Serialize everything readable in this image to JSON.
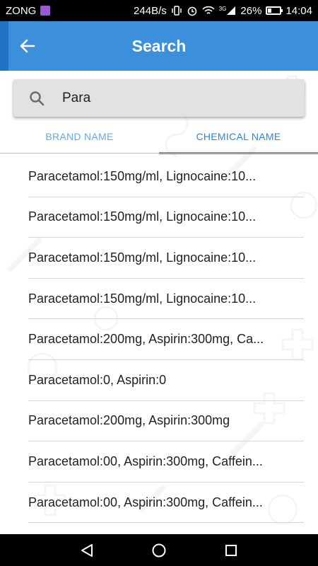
{
  "status_bar": {
    "carrier": "ZONG",
    "data_speed": "244B/s",
    "network_type": "3G",
    "battery_percent": "26%",
    "battery_level": 0.26,
    "time": "14:04",
    "icons": [
      "vibrate-icon",
      "alarm-icon",
      "wifi-icon",
      "signal-icon",
      "battery-icon"
    ]
  },
  "app_bar": {
    "title": "Search",
    "color": "#3b8fdb",
    "back_icon": "arrow-left-icon"
  },
  "search": {
    "value": "Para",
    "icon": "search-icon"
  },
  "tabs": [
    {
      "label": "BRAND NAME",
      "active": false
    },
    {
      "label": "CHEMICAL NAME",
      "active": true
    }
  ],
  "results": [
    "Paracetamol:150mg/ml, Lignocaine:10...",
    "Paracetamol:150mg/ml, Lignocaine:10...",
    "Paracetamol:150mg/ml, Lignocaine:10...",
    "Paracetamol:150mg/ml, Lignocaine:10...",
    "Paracetamol:200mg, Aspirin:300mg, Ca...",
    "Paracetamol:0, Aspirin:0",
    "Paracetamol:200mg, Aspirin:300mg",
    "Paracetamol:00, Aspirin:300mg, Caffein...",
    "Paracetamol:00, Aspirin:300mg, Caffein..."
  ],
  "nav_bar": {
    "icons": [
      "back-triangle-icon",
      "home-circle-icon",
      "recents-square-icon"
    ]
  }
}
